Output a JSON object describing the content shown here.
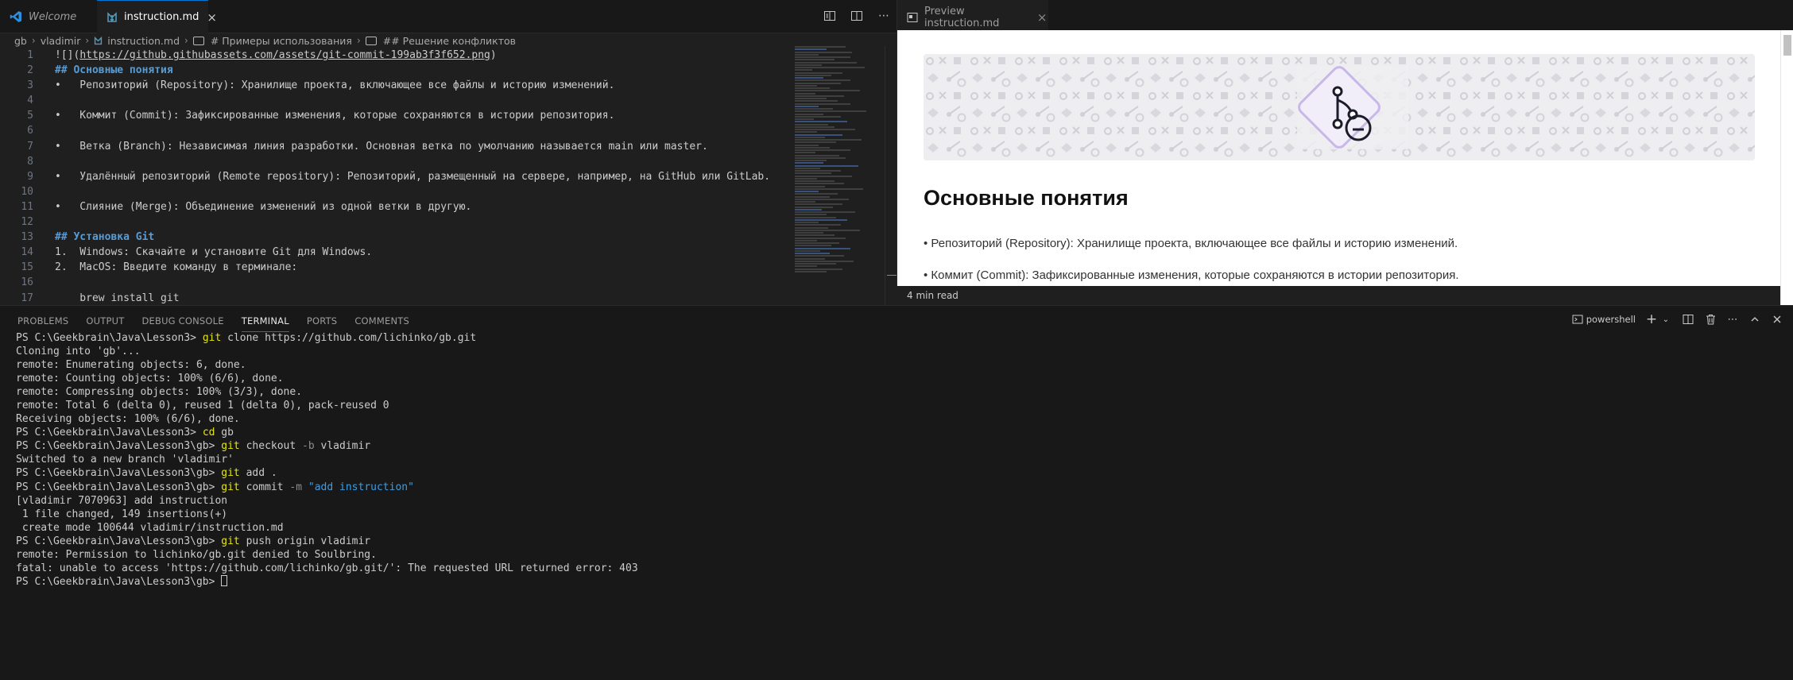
{
  "editor": {
    "tabs": [
      {
        "label": "Welcome",
        "icon": "vscode-icon",
        "active": false
      },
      {
        "label": "instruction.md",
        "icon": "markdown-icon",
        "active": true,
        "close": "×"
      }
    ],
    "breadcrumb": {
      "items": [
        "gb",
        "vladimir",
        "instruction.md",
        "# Примеры использования",
        "## Решение конфликтов"
      ]
    },
    "lines": [
      {
        "n": "1",
        "parts": [
          {
            "t": "![](",
            "c": ""
          },
          {
            "t": "https://github.githubassets.com/assets/git-commit-199ab3f3f652.png",
            "c": "link"
          },
          {
            "t": ")",
            "c": ""
          }
        ]
      },
      {
        "n": "2",
        "parts": [
          {
            "t": "## Основные понятия",
            "c": "heading"
          }
        ]
      },
      {
        "n": "3",
        "parts": [
          {
            "t": "•   Репозиторий (Repository): Хранилище проекта, включающее все файлы и историю изменений.",
            "c": ""
          }
        ]
      },
      {
        "n": "4",
        "parts": []
      },
      {
        "n": "5",
        "parts": [
          {
            "t": "•   Коммит (Commit): Зафиксированные изменения, которые сохраняются в истории репозитория.",
            "c": ""
          }
        ]
      },
      {
        "n": "6",
        "parts": []
      },
      {
        "n": "7",
        "parts": [
          {
            "t": "•   Ветка (Branch): Независимая линия разработки. Основная ветка по умолчанию называется main или master.",
            "c": ""
          }
        ]
      },
      {
        "n": "8",
        "parts": []
      },
      {
        "n": "9",
        "parts": [
          {
            "t": "•   Удалённый репозиторий (Remote repository): Репозиторий, размещенный на сервере, например, на GitHub или GitLab.",
            "c": ""
          }
        ]
      },
      {
        "n": "10",
        "parts": []
      },
      {
        "n": "11",
        "parts": [
          {
            "t": "•   Слияние (Merge): Объединение изменений из одной ветки в другую.",
            "c": ""
          }
        ]
      },
      {
        "n": "12",
        "parts": []
      },
      {
        "n": "13",
        "parts": [
          {
            "t": "## Установка Git",
            "c": "heading"
          }
        ]
      },
      {
        "n": "14",
        "parts": [
          {
            "t": "1.  Windows: Скачайте и установите Git для Windows.",
            "c": ""
          }
        ]
      },
      {
        "n": "15",
        "parts": [
          {
            "t": "2.  MacOS: Введите команду в терминале:",
            "c": ""
          }
        ]
      },
      {
        "n": "16",
        "parts": []
      },
      {
        "n": "17",
        "parts": [
          {
            "t": "    brew install git",
            "c": ""
          }
        ]
      }
    ]
  },
  "preview": {
    "tab_label": "Preview instruction.md",
    "tab_close": "×",
    "heading": "Основные понятия",
    "paragraphs": [
      "• Репозиторий (Repository): Хранилище проекта, включающее все файлы и историю изменений.",
      "• Коммит (Commit): Зафиксированные изменения, которые сохраняются в истории репозитория."
    ],
    "read_time": "4 min read"
  },
  "panel": {
    "tabs": [
      "PROBLEMS",
      "OUTPUT",
      "DEBUG CONSOLE",
      "TERMINAL",
      "PORTS",
      "COMMENTS"
    ],
    "active_tab": "TERMINAL",
    "shell_label": "powershell"
  },
  "terminal": [
    [
      {
        "t": "PS C:\\Geekbrain\\Java\\Lesson3> ",
        "c": ""
      },
      {
        "t": "git",
        "c": "cmd"
      },
      {
        "t": " clone https://github.com/lichinko/gb.git",
        "c": ""
      }
    ],
    [
      {
        "t": "Cloning into 'gb'...",
        "c": ""
      }
    ],
    [
      {
        "t": "remote: Enumerating objects: 6, done.",
        "c": ""
      }
    ],
    [
      {
        "t": "remote: Counting objects: 100% (6/6), done.",
        "c": ""
      }
    ],
    [
      {
        "t": "remote: Compressing objects: 100% (3/3), done.",
        "c": ""
      }
    ],
    [
      {
        "t": "remote: Total 6 (delta 0), reused 1 (delta 0), pack-reused 0",
        "c": ""
      }
    ],
    [
      {
        "t": "Receiving objects: 100% (6/6), done.",
        "c": ""
      }
    ],
    [
      {
        "t": "PS C:\\Geekbrain\\Java\\Lesson3> ",
        "c": ""
      },
      {
        "t": "cd",
        "c": "cmd"
      },
      {
        "t": " gb",
        "c": ""
      }
    ],
    [
      {
        "t": "PS C:\\Geekbrain\\Java\\Lesson3\\gb> ",
        "c": ""
      },
      {
        "t": "git",
        "c": "cmd"
      },
      {
        "t": " checkout ",
        "c": ""
      },
      {
        "t": "-b",
        "c": "flag"
      },
      {
        "t": " vladimir",
        "c": ""
      }
    ],
    [
      {
        "t": "Switched to a new branch 'vladimir'",
        "c": ""
      }
    ],
    [
      {
        "t": "PS C:\\Geekbrain\\Java\\Lesson3\\gb> ",
        "c": ""
      },
      {
        "t": "git",
        "c": "cmd"
      },
      {
        "t": " add .",
        "c": ""
      }
    ],
    [
      {
        "t": "PS C:\\Geekbrain\\Java\\Lesson3\\gb> ",
        "c": ""
      },
      {
        "t": "git",
        "c": "cmd"
      },
      {
        "t": " commit ",
        "c": ""
      },
      {
        "t": "-m",
        "c": "flag"
      },
      {
        "t": " ",
        "c": ""
      },
      {
        "t": "\"add instruction\"",
        "c": "str"
      }
    ],
    [
      {
        "t": "[vladimir 7070963] add instruction",
        "c": ""
      }
    ],
    [
      {
        "t": " 1 file changed, 149 insertions(+)",
        "c": ""
      }
    ],
    [
      {
        "t": " create mode 100644 vladimir/instruction.md",
        "c": ""
      }
    ],
    [
      {
        "t": "PS C:\\Geekbrain\\Java\\Lesson3\\gb> ",
        "c": ""
      },
      {
        "t": "git",
        "c": "cmd"
      },
      {
        "t": " push origin vladimir",
        "c": ""
      }
    ],
    [
      {
        "t": "remote: Permission to lichinko/gb.git denied to Soulbring.",
        "c": ""
      }
    ],
    [
      {
        "t": "fatal: unable to access 'https://github.com/lichinko/gb.git/': The requested URL returned error: 403",
        "c": ""
      }
    ],
    [
      {
        "t": "PS C:\\Geekbrain\\Java\\Lesson3\\gb> ",
        "c": ""
      }
    ]
  ],
  "colors": {
    "accent": "#0078d4",
    "heading": "#569cd6",
    "command": "#e5e510",
    "string": "#3b9ee7"
  }
}
